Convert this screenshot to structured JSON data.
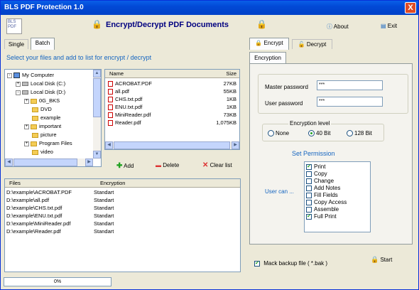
{
  "window": {
    "title": "BLS PDF Protection 1.0",
    "close_glyph": "X"
  },
  "logo": {
    "lines": [
      "BLS",
      "PDF"
    ]
  },
  "header": {
    "title": "Encrypt/Decrypt PDF Documents",
    "about_label": "About",
    "exit_label": "Exit"
  },
  "mode_tabs": {
    "single": "Single",
    "batch": "Batch"
  },
  "instruction": "Select your files and add to list for encrypt / decrypt",
  "tree": {
    "items": [
      {
        "label": "My Computer",
        "kind": "pc",
        "indent": 0,
        "exp": "-"
      },
      {
        "label": "Local Disk (C:)",
        "kind": "drive",
        "indent": 1,
        "exp": "+"
      },
      {
        "label": "Local Disk (D:)",
        "kind": "drive",
        "indent": 1,
        "exp": "-"
      },
      {
        "label": "0G_BKS",
        "kind": "folder",
        "indent": 2,
        "exp": "+"
      },
      {
        "label": "DVD",
        "kind": "folder",
        "indent": 2,
        "exp": ""
      },
      {
        "label": "example",
        "kind": "folder",
        "indent": 2,
        "exp": ""
      },
      {
        "label": "important",
        "kind": "folder",
        "indent": 2,
        "exp": "+"
      },
      {
        "label": "picture",
        "kind": "folder",
        "indent": 2,
        "exp": ""
      },
      {
        "label": "Program Files",
        "kind": "folder",
        "indent": 2,
        "exp": "+"
      },
      {
        "label": "video",
        "kind": "folder",
        "indent": 2,
        "exp": ""
      }
    ]
  },
  "file_list": {
    "col_name": "Name",
    "col_size": "Size",
    "rows": [
      {
        "name": "ACROBAT.PDF",
        "size": "27KB"
      },
      {
        "name": "all.pdf",
        "size": "55KB"
      },
      {
        "name": "CHS.txt.pdf",
        "size": "1KB"
      },
      {
        "name": "ENU.txt.pdf",
        "size": "1KB"
      },
      {
        "name": "MiniReader.pdf",
        "size": "73KB"
      },
      {
        "name": "Reader.pdf",
        "size": "1,075KB"
      }
    ]
  },
  "actions": {
    "add": "Add",
    "delete": "Delete",
    "clear": "Clear list"
  },
  "queue": {
    "col_files": "Files",
    "col_encryption": "Encryption",
    "rows": [
      {
        "file": "D:\\example\\ACROBAT.PDF",
        "enc": "Standart"
      },
      {
        "file": "D:\\example\\all.pdf",
        "enc": "Standart"
      },
      {
        "file": "D:\\example\\CHS.txt.pdf",
        "enc": "Standart"
      },
      {
        "file": "D:\\example\\ENU.txt.pdf",
        "enc": "Standart"
      },
      {
        "file": "D:\\example\\MiniReader.pdf",
        "enc": "Standart"
      },
      {
        "file": "D:\\example\\Reader.pdf",
        "enc": "Standart"
      }
    ]
  },
  "right_tabs": {
    "encrypt": "Encrypt",
    "decrypt": "Decrypt",
    "sub_tab": "Encryption"
  },
  "passwords": {
    "master_label": "Master password",
    "master_value": "***",
    "user_label": "User password",
    "user_value": "***"
  },
  "encryption_level": {
    "title": "Encryption level",
    "none": "None",
    "bit40": "40 Bit",
    "bit128": "128 Bit",
    "selected": "40 Bit"
  },
  "permissions": {
    "title": "Set Permission",
    "user_can": "User can ...",
    "items": [
      {
        "label": "Print",
        "checked": true
      },
      {
        "label": "Copy",
        "checked": false
      },
      {
        "label": "Change",
        "checked": false
      },
      {
        "label": "Add Notes",
        "checked": false
      },
      {
        "label": "Fill Fields",
        "checked": false
      },
      {
        "label": "Copy Access",
        "checked": false
      },
      {
        "label": "Assemble",
        "checked": false
      },
      {
        "label": "Full Print",
        "checked": true
      }
    ]
  },
  "backup": {
    "label": "Mack backup file ( *.bak )",
    "checked": true
  },
  "start_label": "Start",
  "progress": "0%",
  "colors": {
    "accent_blue": "#1565c0",
    "title_blue": "#0249d6"
  }
}
